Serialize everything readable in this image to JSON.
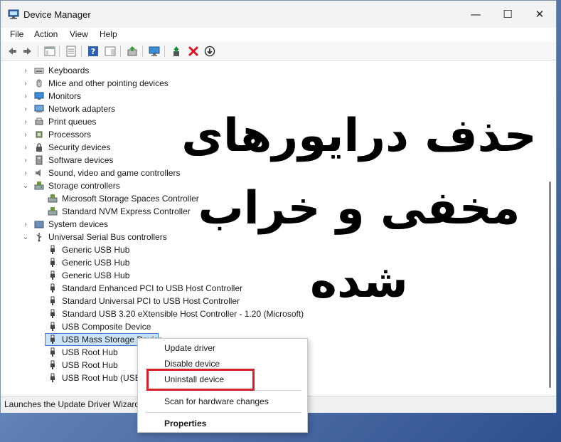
{
  "window": {
    "title": "Device Manager",
    "controls": {
      "minimize": "—",
      "maximize": "☐",
      "close": "✕"
    }
  },
  "menu": [
    "File",
    "Action",
    "View",
    "Help"
  ],
  "toolbar": {
    "icons": [
      "back-arrow-icon",
      "forward-arrow-icon",
      "show-hide-console-tree-icon",
      "properties-icon",
      "help-icon",
      "show-action-pane-icon",
      "update-driver-icon",
      "monitor-icon",
      "enable-device-icon",
      "uninstall-device-icon",
      "disable-device-icon"
    ]
  },
  "tree": {
    "rows": [
      {
        "label": "Keyboards",
        "level": 1,
        "expanded": false,
        "icon": "keyboard-icon"
      },
      {
        "label": "Mice and other pointing devices",
        "level": 1,
        "expanded": false,
        "icon": "mouse-icon"
      },
      {
        "label": "Monitors",
        "level": 1,
        "expanded": false,
        "icon": "monitor-icon"
      },
      {
        "label": "Network adapters",
        "level": 1,
        "expanded": false,
        "icon": "network-icon"
      },
      {
        "label": "Print queues",
        "level": 1,
        "expanded": false,
        "icon": "printer-icon"
      },
      {
        "label": "Processors",
        "level": 1,
        "expanded": false,
        "icon": "processor-icon"
      },
      {
        "label": "Security devices",
        "level": 1,
        "expanded": false,
        "icon": "security-icon"
      },
      {
        "label": "Software devices",
        "level": 1,
        "expanded": false,
        "icon": "software-icon"
      },
      {
        "label": "Sound, video and game controllers",
        "level": 1,
        "expanded": false,
        "icon": "speaker-icon"
      },
      {
        "label": "Storage controllers",
        "level": 1,
        "expanded": true,
        "icon": "storage-icon"
      },
      {
        "label": "Microsoft Storage Spaces Controller",
        "level": 2,
        "icon": "storage-controller-icon"
      },
      {
        "label": "Standard NVM Express Controller",
        "level": 2,
        "icon": "storage-controller-icon"
      },
      {
        "label": "System devices",
        "level": 1,
        "expanded": false,
        "icon": "system-folder-icon"
      },
      {
        "label": "Universal Serial Bus controllers",
        "level": 1,
        "expanded": true,
        "icon": "usb-icon"
      },
      {
        "label": "Generic USB Hub",
        "level": 2,
        "icon": "usb-plug-icon"
      },
      {
        "label": "Generic USB Hub",
        "level": 2,
        "icon": "usb-plug-icon"
      },
      {
        "label": "Generic USB Hub",
        "level": 2,
        "icon": "usb-plug-icon"
      },
      {
        "label": "Standard Enhanced PCI to USB Host Controller",
        "level": 2,
        "icon": "usb-plug-icon"
      },
      {
        "label": "Standard Universal PCI to USB Host Controller",
        "level": 2,
        "icon": "usb-plug-icon"
      },
      {
        "label": "Standard USB 3.20 eXtensible Host Controller - 1.20 (Microsoft)",
        "level": 2,
        "icon": "usb-plug-icon"
      },
      {
        "label": "USB Composite Device",
        "level": 2,
        "icon": "usb-plug-icon"
      },
      {
        "label": "USB Mass Storage Device",
        "level": 2,
        "icon": "usb-plug-icon",
        "selected": true
      },
      {
        "label": "USB Root Hub",
        "level": 2,
        "icon": "usb-plug-icon"
      },
      {
        "label": "USB Root Hub",
        "level": 2,
        "icon": "usb-plug-icon"
      },
      {
        "label": "USB Root Hub (USB 3.0)",
        "level": 2,
        "icon": "usb-plug-icon"
      }
    ]
  },
  "status": {
    "text": "Launches the Update Driver Wizard for the selected device."
  },
  "context_menu": {
    "items": [
      {
        "label": "Update driver",
        "bold": false
      },
      {
        "label": "Disable device",
        "bold": false
      },
      {
        "label": "Uninstall device",
        "bold": false,
        "highlighted": true
      },
      {
        "label": "Scan for hardware changes",
        "bold": false
      },
      {
        "label": "Properties",
        "bold": true
      }
    ]
  },
  "overlay": {
    "line1": "حذف درایورهای",
    "line2": "مخفی و خراب شده"
  },
  "colors": {
    "selection": "#cce4f7",
    "selection_border": "#3a7bd5",
    "highlight_box": "#d6202a",
    "uninstall_red": "#e81123",
    "enable_green": "#1e8f3e"
  }
}
